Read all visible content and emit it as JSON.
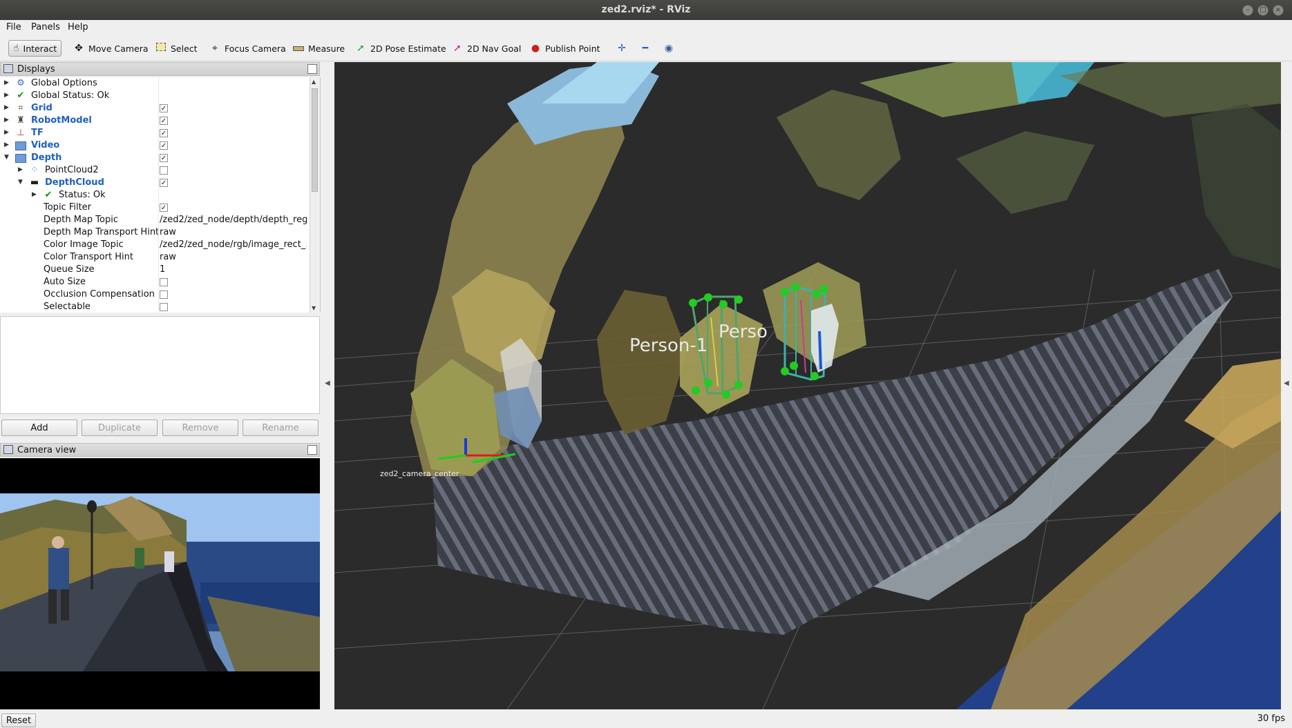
{
  "window": {
    "title": "zed2.rviz* - RViz"
  },
  "menu": [
    "File",
    "Panels",
    "Help"
  ],
  "toolbar": {
    "tools": [
      {
        "label": "Interact",
        "icon": "hand-icon",
        "active": true
      },
      {
        "label": "Move Camera",
        "icon": "move-camera-icon"
      },
      {
        "label": "Select",
        "icon": "select-icon"
      },
      {
        "label": "Focus Camera",
        "icon": "focus-camera-icon"
      },
      {
        "label": "Measure",
        "icon": "ruler-icon"
      },
      {
        "label": "2D Pose Estimate",
        "icon": "pose-arrow-icon"
      },
      {
        "label": "2D Nav Goal",
        "icon": "nav-goal-icon"
      },
      {
        "label": "Publish Point",
        "icon": "map-pin-icon"
      }
    ]
  },
  "displays": {
    "title": "Displays",
    "items": [
      {
        "name": "Global Options",
        "icon": "gear-icon"
      },
      {
        "name": "Global Status: Ok",
        "icon": "checkmark-icon"
      },
      {
        "name": "Grid",
        "icon": "grid-icon",
        "checked": true
      },
      {
        "name": "RobotModel",
        "icon": "robot-icon",
        "checked": true
      },
      {
        "name": "TF",
        "icon": "tf-axes-icon",
        "checked": true
      },
      {
        "name": "Video",
        "icon": "folder-icon",
        "checked": true
      },
      {
        "name": "Depth",
        "icon": "folder-icon",
        "checked": true
      },
      {
        "name": "PointCloud2",
        "icon": "pointcloud-icon",
        "checked": false
      },
      {
        "name": "DepthCloud",
        "icon": "depthcloud-icon",
        "checked": true
      },
      {
        "name": "Status: Ok",
        "icon": "checkmark-icon"
      }
    ],
    "properties": [
      {
        "name": "Topic Filter",
        "checked": true
      },
      {
        "name": "Depth Map Topic",
        "value": "/zed2/zed_node/depth/depth_reg..."
      },
      {
        "name": "Depth Map Transport Hint",
        "value": "raw"
      },
      {
        "name": "Color Image Topic",
        "value": "/zed2/zed_node/rgb/image_rect_..."
      },
      {
        "name": "Color Transport Hint",
        "value": "raw"
      },
      {
        "name": "Queue Size",
        "value": "1"
      },
      {
        "name": "Auto Size",
        "checked": false
      },
      {
        "name": "Occlusion Compensation",
        "checked": false
      },
      {
        "name": "Selectable",
        "checked": false
      }
    ],
    "buttons": {
      "add": "Add",
      "duplicate": "Duplicate",
      "remove": "Remove",
      "rename": "Rename"
    }
  },
  "camera_view": {
    "title": "Camera view"
  },
  "viewport": {
    "labels": {
      "person1": "Person-1",
      "person2": "Perso"
    },
    "frame_label": "zed2_camera_center"
  },
  "status": {
    "reset": "Reset",
    "fps": "30 fps"
  }
}
